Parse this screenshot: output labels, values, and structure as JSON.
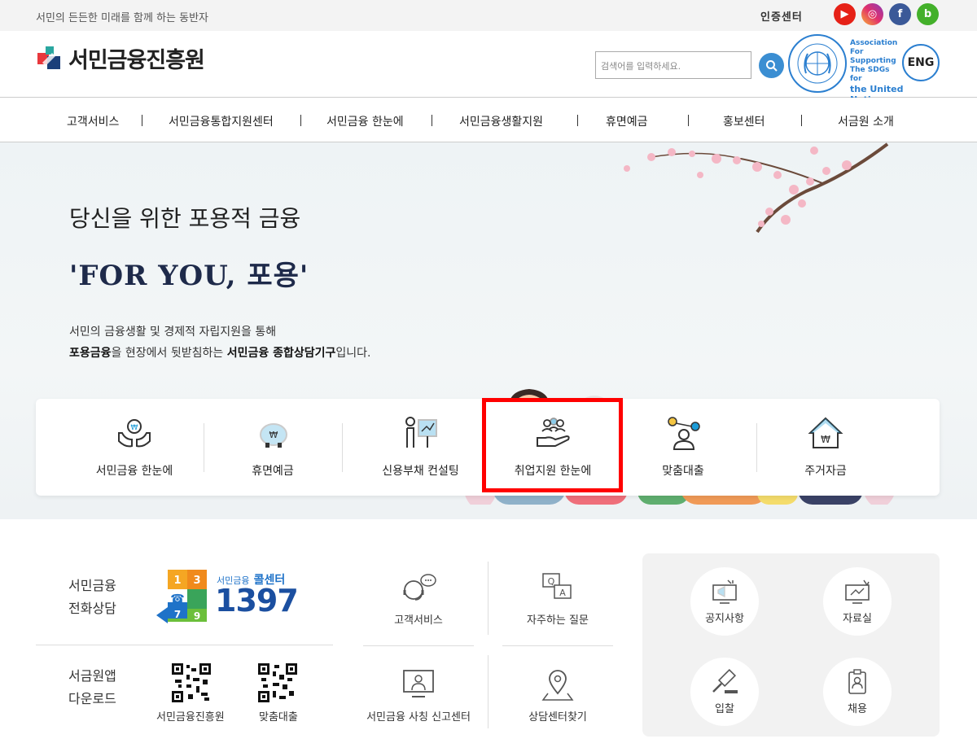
{
  "topbar": {
    "slogan": "서민의 든든한 미래를 함께 하는 동반자",
    "cert": "인증센터",
    "sns": [
      {
        "name": "youtube-icon",
        "glyph": "▶"
      },
      {
        "name": "instagram-icon",
        "glyph": "◎"
      },
      {
        "name": "facebook-icon",
        "glyph": "f"
      },
      {
        "name": "blog-icon",
        "glyph": "b"
      }
    ]
  },
  "header": {
    "logo_text": "서민금융진흥원",
    "search_placeholder": "검색어를 입력하세요.",
    "un_line1": "Association",
    "un_line2": "For Supporting",
    "un_line3": "The SDGs for",
    "un_line4": "the United",
    "un_line5": "Nations",
    "eng_label": "ENG"
  },
  "gnb": [
    "고객서비스",
    "서민금융통합지원센터",
    "서민금융 한눈에",
    "서민금융생활지원",
    "휴면예금",
    "홍보센터",
    "서금원 소개"
  ],
  "hero": {
    "title": "당신을 위한 포용적 금융",
    "slogan": "'FOR YOU, 포용'",
    "desc1": "서민의 금융생활 및 경제적 자립지원을 통해",
    "desc2_b1": "포용금융",
    "desc2_t1": "을 현장에서 뒷받침하는 ",
    "desc2_b2": "서민금융 종합상담기구",
    "desc2_t2": "입니다."
  },
  "quick_menu": [
    {
      "label": "서민금융 한눈에",
      "icon": "hands-coin-icon"
    },
    {
      "label": "휴면예금",
      "icon": "piggy-bank-icon"
    },
    {
      "label": "신용부채 컨설팅",
      "icon": "presentation-icon"
    },
    {
      "label": "취업지원 한눈에",
      "icon": "hand-people-icon"
    },
    {
      "label": "맞춤대출",
      "icon": "person-network-icon"
    },
    {
      "label": "주거자금",
      "icon": "house-won-icon"
    }
  ],
  "bottom": {
    "phone_title_1": "서민금융",
    "phone_title_2": "전화상담",
    "callcenter_small": "서민금융",
    "callcenter_label": "콜센터",
    "callcenter_number": "1397",
    "app_title_1": "서금원앱",
    "app_title_2": "다운로드",
    "qr1_label": "서민금융진흥원",
    "qr2_label": "맞춤대출",
    "mid_items": [
      {
        "label": "고객서비스",
        "icon": "headset-chat-icon"
      },
      {
        "label": "자주하는 질문",
        "icon": "qa-icon"
      },
      {
        "label": "서민금융 사칭 신고센터",
        "icon": "monitor-person-icon"
      },
      {
        "label": "상담센터찾기",
        "icon": "map-pin-icon"
      }
    ],
    "side_items": [
      {
        "label": "공지사항",
        "icon": "megaphone-monitor-icon"
      },
      {
        "label": "자료실",
        "icon": "data-monitor-icon"
      },
      {
        "label": "입찰",
        "icon": "gavel-icon"
      },
      {
        "label": "채용",
        "icon": "id-badge-icon"
      }
    ]
  }
}
